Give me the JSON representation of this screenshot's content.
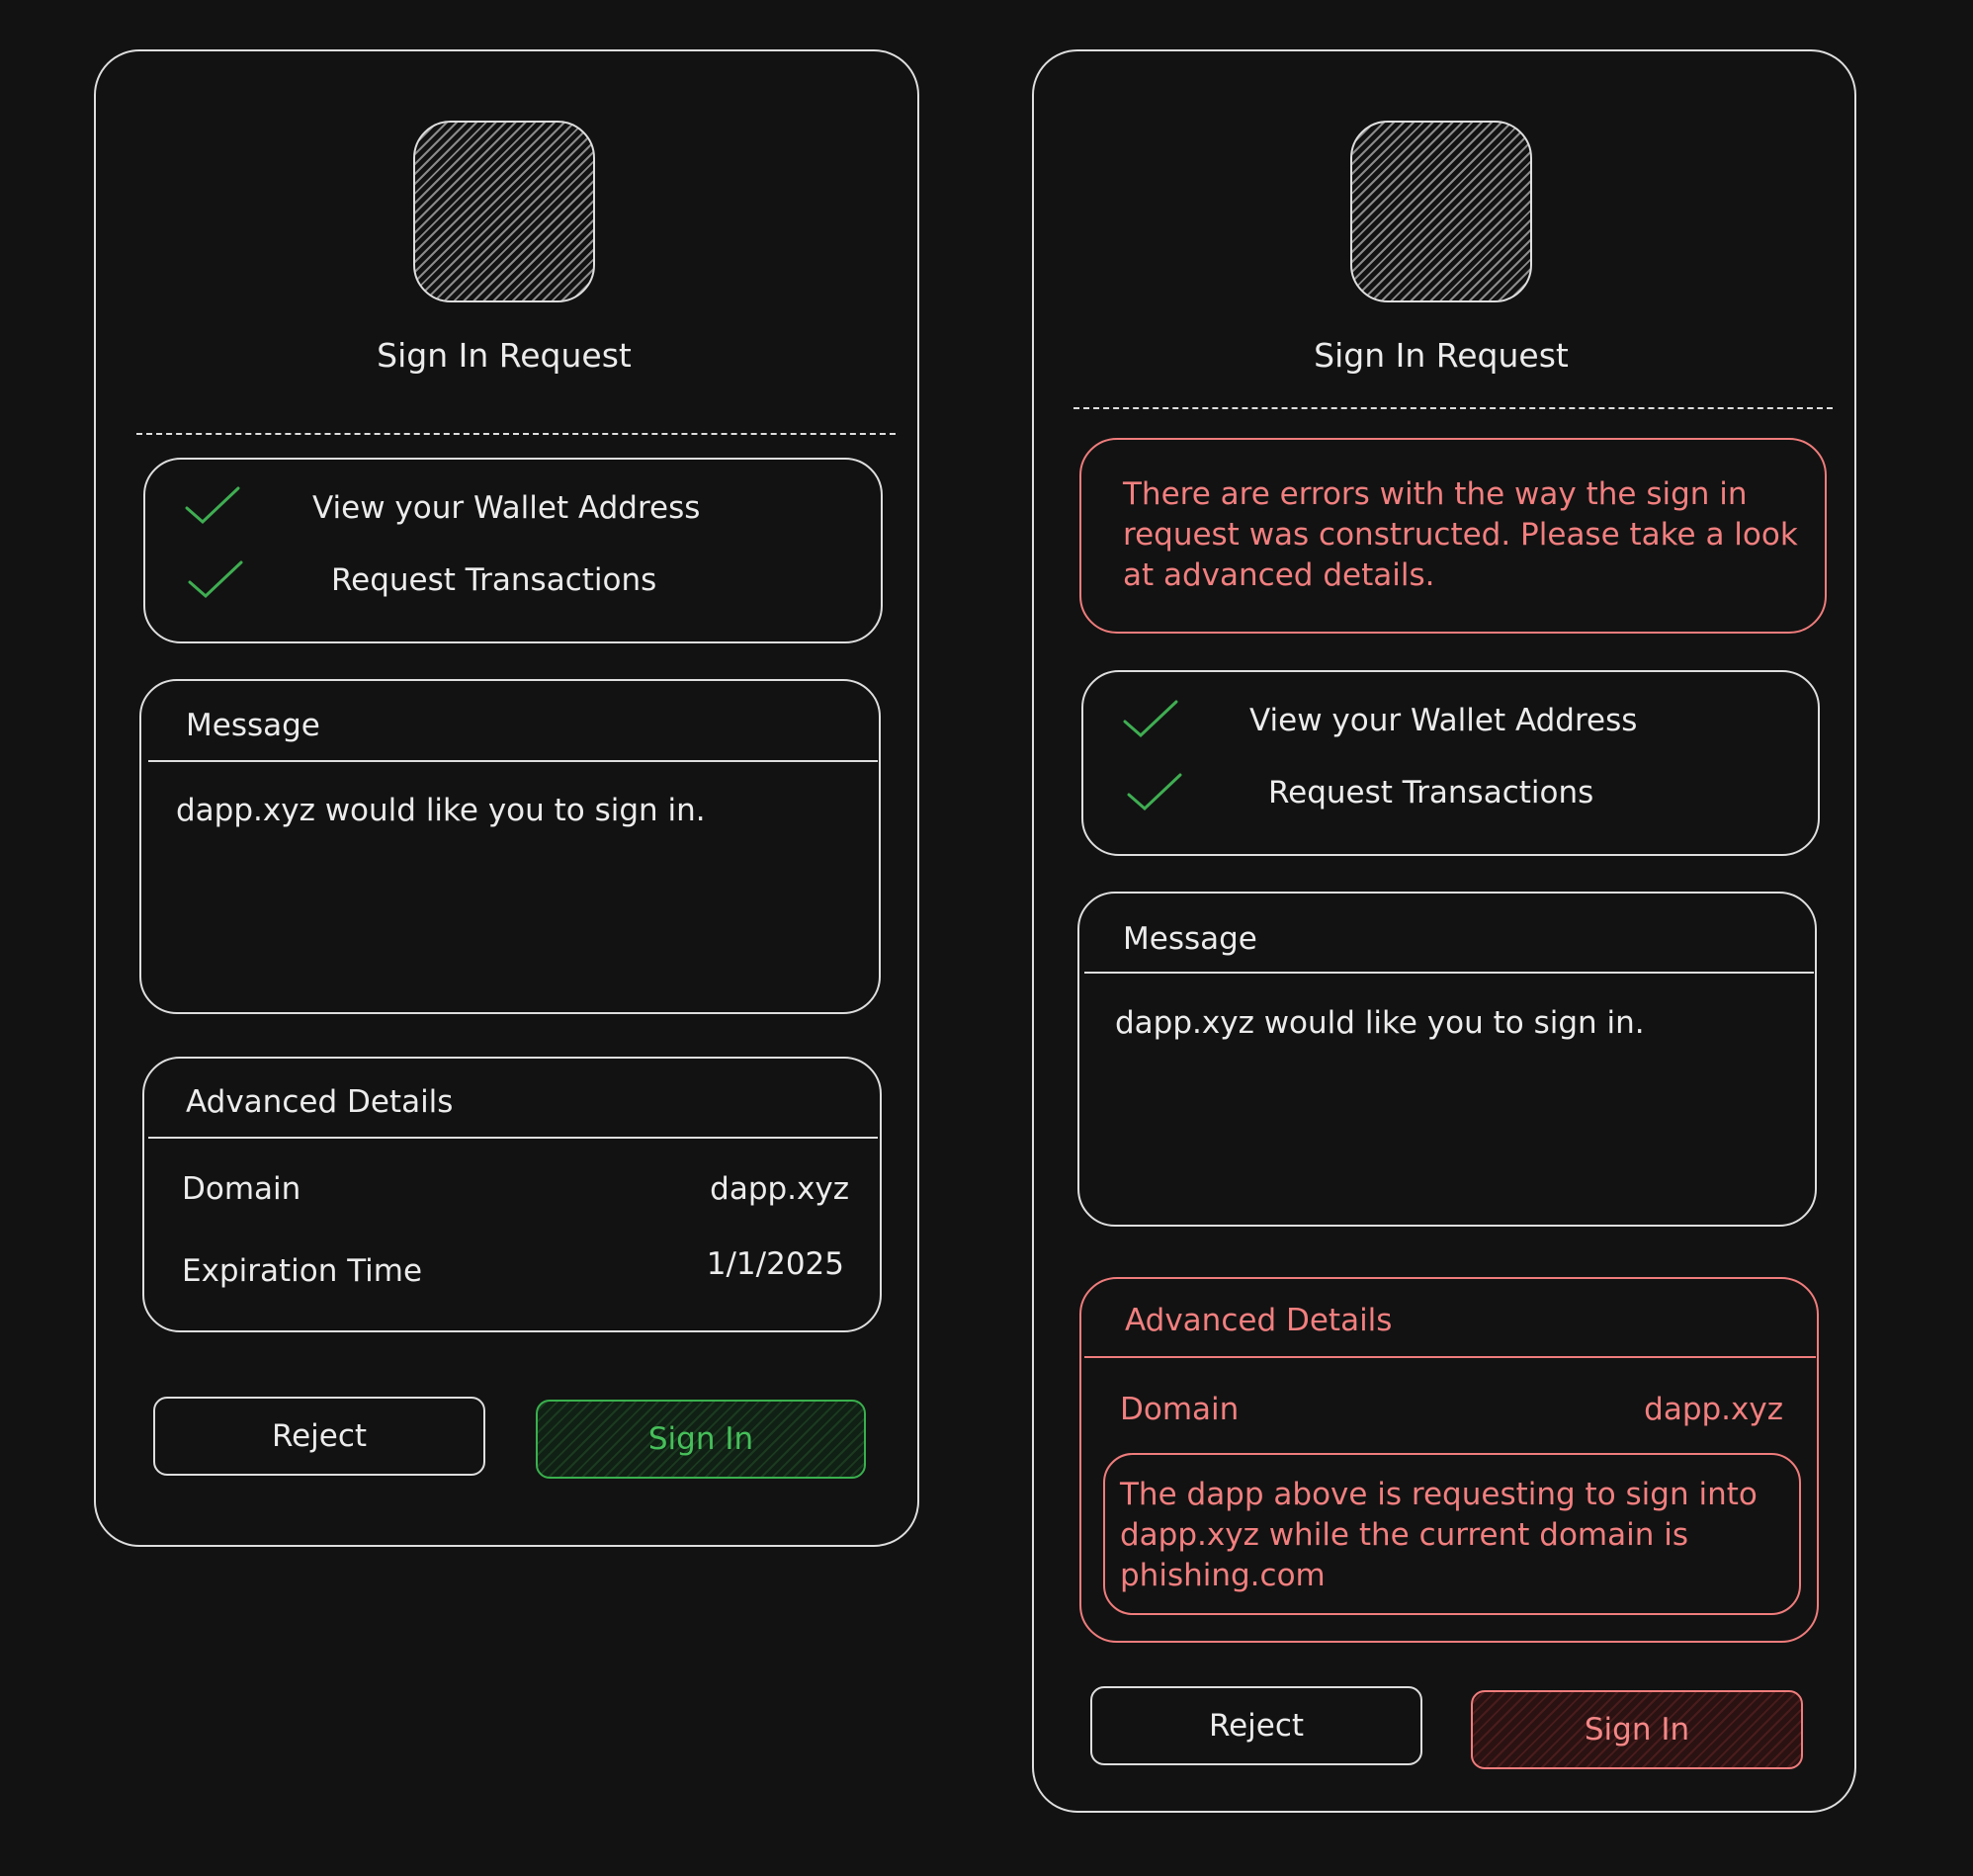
{
  "left": {
    "title": "Sign In Request",
    "permissions": [
      "View your Wallet Address",
      "Request Transactions"
    ],
    "message_header": "Message",
    "message_body": "dapp.xyz would like you to sign in.",
    "advanced_header": "Advanced Details",
    "domain_label": "Domain",
    "domain_value": "dapp.xyz",
    "expiration_label": "Expiration Time",
    "expiration_value": "1/1/2025",
    "reject_label": "Reject",
    "signin_label": "Sign In"
  },
  "right": {
    "title": "Sign In Request",
    "error_text": "There are errors with the way the sign in request was constructed. Please take a look at advanced details.",
    "permissions": [
      "View your Wallet Address",
      "Request Transactions"
    ],
    "message_header": "Message",
    "message_body": "dapp.xyz would like you to sign in.",
    "advanced_header": "Advanced Details",
    "domain_label": "Domain",
    "domain_value": "dapp.xyz",
    "domain_warning": "The dapp above is requesting to sign into dapp.xyz while the current domain is phishing.com",
    "reject_label": "Reject",
    "signin_label": "Sign In"
  },
  "colors": {
    "background": "#121212",
    "outline": "#dedede",
    "success": "#46c05a",
    "danger": "#f27f7f"
  },
  "icons": [
    "app-logo-placeholder-icon",
    "checkmark-icon"
  ]
}
